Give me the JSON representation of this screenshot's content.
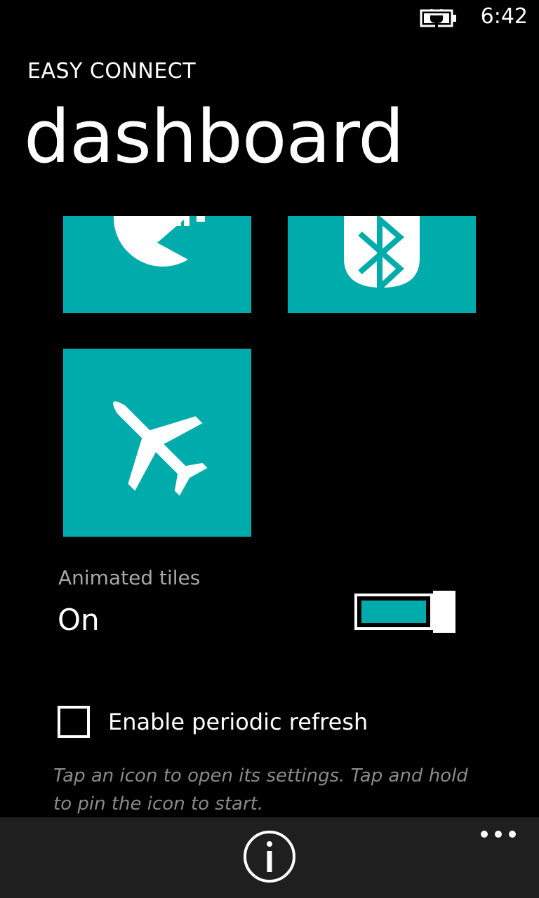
{
  "status_bar": {
    "time": "6:42",
    "battery_icon": "battery-charging-icon"
  },
  "header": {
    "app_title": "EASY CONNECT",
    "page_title": "dashboard"
  },
  "tiles": [
    {
      "name": "wifi",
      "icon": "wifi-icon",
      "color": "#00abab"
    },
    {
      "name": "bluetooth",
      "icon": "bluetooth-icon",
      "color": "#00abab"
    },
    {
      "name": "airplane-mode",
      "icon": "airplane-icon",
      "color": "#00abab"
    }
  ],
  "animated_tiles": {
    "label": "Animated tiles",
    "value": "On",
    "enabled": true
  },
  "periodic_refresh": {
    "label": "Enable periodic refresh",
    "checked": false
  },
  "hint": "Tap an icon to open its settings. Tap and hold to pin the icon to start.",
  "app_bar": {
    "info_icon": "info-icon",
    "more_icon": "ellipsis-icon",
    "background": "#1f1f1f"
  },
  "colors": {
    "accent": "#00abab",
    "background": "#000000",
    "label_gray": "#a8a8a8",
    "hint_gray": "#8a8a8a"
  }
}
